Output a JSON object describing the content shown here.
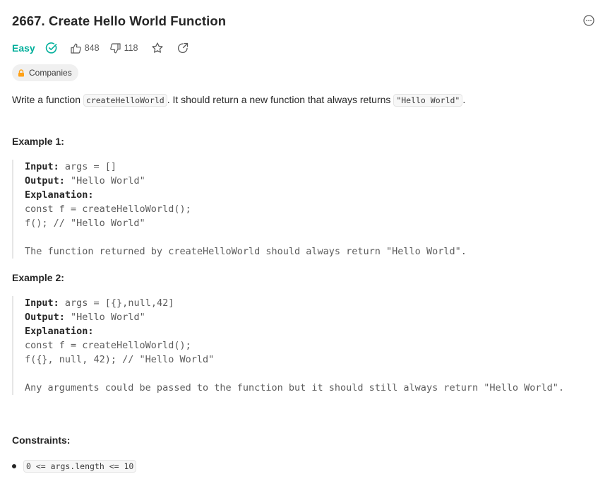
{
  "problem": {
    "title": "2667. Create Hello World Function",
    "difficulty": "Easy",
    "likes": "848",
    "dislikes": "118",
    "companies_label": "Companies",
    "colors": {
      "difficulty": "#00af9b",
      "lock": "#ffa116",
      "solved": "#00af9b"
    },
    "icons": {
      "more": "more-horizontal-circle-icon",
      "solved": "check-circle-icon",
      "like": "thumbs-up-icon",
      "dislike": "thumbs-down-icon",
      "favorite": "star-icon",
      "share": "share-arrow-icon",
      "lock": "lock-icon"
    }
  },
  "description": {
    "text1": "Write a function ",
    "code1": "createHelloWorld",
    "text2": ". It should return a new function that always returns ",
    "code2": "\"Hello World\"",
    "text3": "."
  },
  "examples": [
    {
      "title": "Example 1:",
      "input_label": "Input:",
      "input_value": " args = []",
      "output_label": "Output:",
      "output_value": " \"Hello World\"",
      "explanation_label": "Explanation:",
      "code_lines": [
        "const f = createHelloWorld();",
        "f(); // \"Hello World\""
      ],
      "note": "The function returned by createHelloWorld should always return \"Hello World\"."
    },
    {
      "title": "Example 2:",
      "input_label": "Input:",
      "input_value": " args = [{},null,42]",
      "output_label": "Output:",
      "output_value": " \"Hello World\"",
      "explanation_label": "Explanation:",
      "code_lines": [
        "const f = createHelloWorld();",
        "f({}, null, 42); // \"Hello World\""
      ],
      "note": "Any arguments could be passed to the function but it should still always return \"Hello World\"."
    }
  ],
  "constraints": {
    "title": "Constraints:",
    "items": [
      "0 <= args.length <= 10"
    ]
  }
}
